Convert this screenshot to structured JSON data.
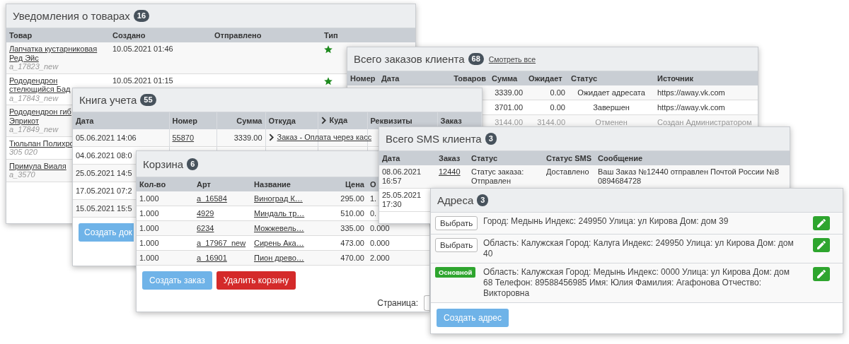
{
  "notifications": {
    "title": "Уведомления о товарах",
    "count": "16",
    "columns": [
      "Товар",
      "Создано",
      "Отправлено",
      "Тип"
    ],
    "rows": [
      {
        "product": "Лапчатка кустарниковая\nРед Эйс",
        "sku": "a_17823_new",
        "created": "10.05.2021 01:46",
        "starred": true
      },
      {
        "product": "Рододендрон\nстелющийся Бад",
        "sku": "a_17843_new",
        "created": "10.05.2021 01:15",
        "starred": true
      },
      {
        "product": "Рододендрон гиб\nЭприкот",
        "sku": "a_17849_new"
      },
      {
        "product": "Тюльпан Полихро",
        "sku": "305 020"
      },
      {
        "product": "Примула Виаля",
        "sku": "a_3570"
      }
    ]
  },
  "orders": {
    "title": "Всего заказов клиента",
    "count": "68",
    "link": "Смотреть все",
    "columns": [
      "Номер",
      "Дата",
      "Товаров",
      "Сумма",
      "Ожидает",
      "Статус",
      "Источник"
    ],
    "rows": [
      {
        "sum": "3339.00",
        "waiting": "0.00",
        "status": "Ожидает адресата",
        "source": "https://away.vk.com",
        "cancelled": false
      },
      {
        "sum": "3701.00",
        "waiting": "0.00",
        "status": "Завершен",
        "source": "https://away.vk.com",
        "cancelled": false
      },
      {
        "sum": "3144.00",
        "waiting": "3144.00",
        "status": "Отменен",
        "source": "Создан Администратором",
        "cancelled": true
      }
    ]
  },
  "ledger": {
    "title": "Книга учета",
    "count": "55",
    "columns": [
      {
        "label": "Дата"
      },
      {
        "label": "Номер"
      },
      {
        "label": "Сумма"
      },
      {
        "label": "Откуда"
      },
      {
        "label": "Куда",
        "arrow": true
      },
      {
        "label": "Реквизиты"
      },
      {
        "label": "Заказ"
      }
    ],
    "rows": [
      {
        "date": "05.06.2021 14:06",
        "number": "55870",
        "sum": "3339.00",
        "from": "Заказ - Оплата через касс"
      },
      {
        "date": "04.06.2021 08:0"
      },
      {
        "date": "25.05.2021 14:5"
      },
      {
        "date": "17.05.2021 07:2"
      },
      {
        "date": "15.05.2021 15:5"
      }
    ],
    "button": "Создать док"
  },
  "cart": {
    "title": "Корзина",
    "count": "6",
    "columns": [
      "Кол-во",
      "Арт",
      "Название",
      "Цена",
      "О"
    ],
    "rows": [
      {
        "qty": "1.000",
        "sku": "a_16584",
        "name": "Виноград К…",
        "price": "295.00",
        "column_5": "1."
      },
      {
        "qty": "1.000",
        "sku": "4929",
        "name": "Миндаль тр…",
        "price": "510.00",
        "column_5": "0."
      },
      {
        "qty": "1.000",
        "sku": "6234",
        "name": "Можжевель…",
        "price": "335.00",
        "column_5": "0.000"
      },
      {
        "qty": "1.000",
        "sku": "a_17967_new",
        "name": "Сирень Ака…",
        "price": "473.00",
        "column_5": "0.000"
      },
      {
        "qty": "1.000",
        "sku": "a_16901",
        "name": "Пион древо…",
        "price": "470.00",
        "column_5": "2.000"
      }
    ],
    "create_button": "Создать заказ",
    "delete_button": "Удалить корзину",
    "page_label": "Страница:"
  },
  "sms": {
    "title": "Всего SMS клиента",
    "count": "3",
    "columns": [
      "Дата",
      "Заказ",
      "Статус",
      "Статус SMS",
      "Сообщение"
    ],
    "rows": [
      {
        "date": "08.06.2021 16:57",
        "order": "12440",
        "status": "Статус заказа: Отправлен",
        "sms_status": "Доставлено",
        "message": "Ваш Заказ №12440 отправлен Почтой России №8 0894684728"
      },
      {
        "date": "25.05.2021 17:30"
      }
    ]
  },
  "addresses": {
    "title": "Адреса",
    "count": "3",
    "items": [
      {
        "kind": "select",
        "button": "Выбрать",
        "text": "Город: Медынь Индекс: 249950 Улица: ул Кирова Дом: дом 39"
      },
      {
        "kind": "select",
        "button": "Выбрать",
        "text": "Область: Калужская Город: Калуга Индекс: 249950 Улица: ул Кирова Дом: дом 40"
      },
      {
        "kind": "primary",
        "badge": "Основной",
        "text": "Область: Калужская Город: Медынь Индекс: 0000 Улица: ул Кирова Дом: дом 68 Телефон: 89588456985 Имя: Юлия Фамилия: Агафонова Отчество: Викторовна"
      }
    ],
    "button": "Создать адрес"
  }
}
